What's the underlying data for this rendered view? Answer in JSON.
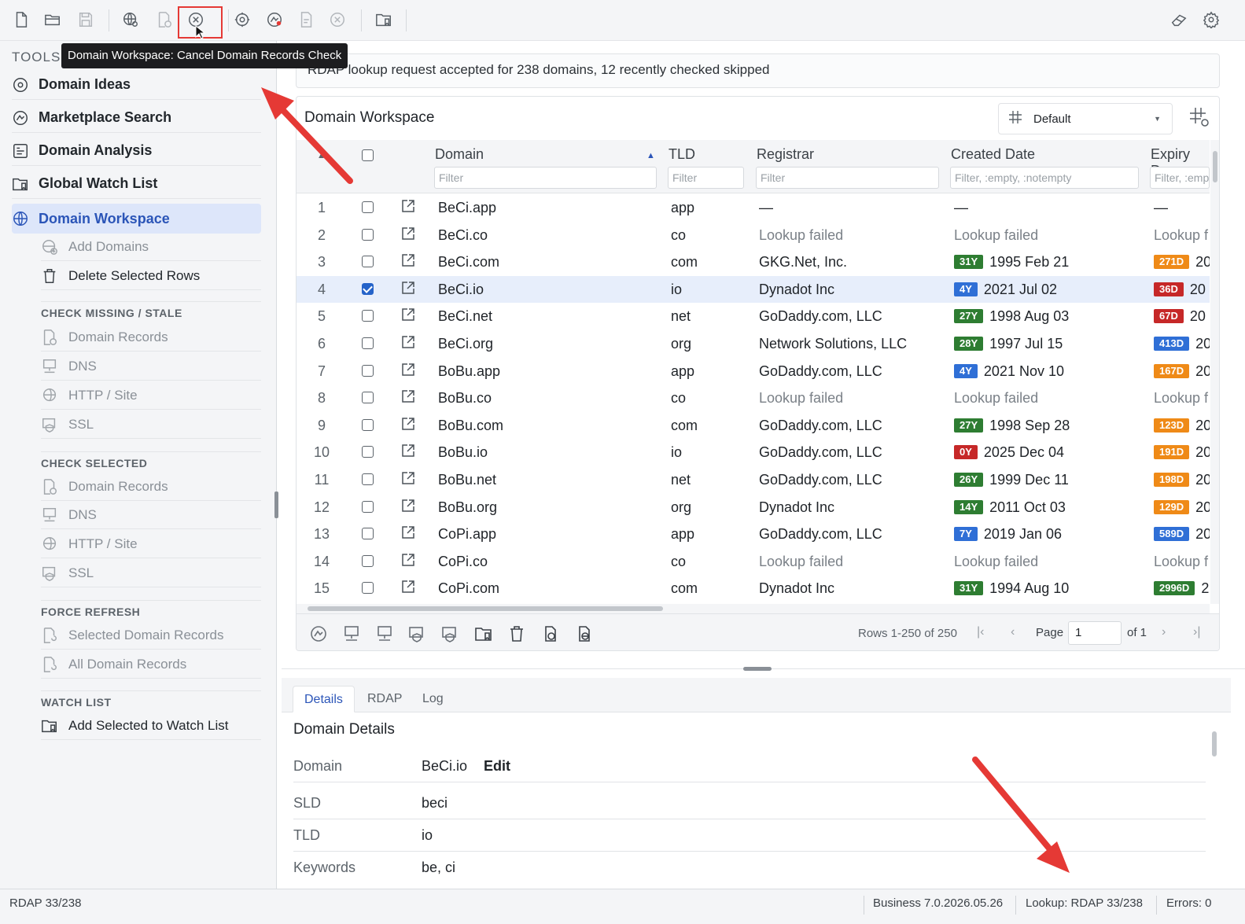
{
  "toolbar": {
    "buttons": [
      {
        "name": "new-icon",
        "disabled": false
      },
      {
        "name": "open-folder-icon",
        "disabled": false
      },
      {
        "name": "save-icon",
        "disabled": true
      },
      {
        "name": "globe-search-icon",
        "disabled": false
      },
      {
        "name": "domain-records-icon",
        "disabled": true
      },
      {
        "name": "cancel-circle-icon",
        "disabled": false
      },
      {
        "name": "gear-badge-icon",
        "disabled": false
      },
      {
        "name": "marketplace-icon",
        "disabled": false
      },
      {
        "name": "document-check-icon",
        "disabled": true
      },
      {
        "name": "cancel-circle-icon",
        "disabled": true
      },
      {
        "name": "watchlist-folder-icon",
        "disabled": false
      },
      {
        "name": "eraser-icon",
        "disabled": false
      },
      {
        "name": "settings-gear-icon",
        "disabled": false
      }
    ],
    "tooltip": "Domain Workspace: Cancel Domain Records Check"
  },
  "sidebar": {
    "tools_label": "TOOLS",
    "main_items": [
      {
        "label": "Domain Ideas",
        "icon": "lightbulb-gear-icon",
        "active": false
      },
      {
        "label": "Marketplace Search",
        "icon": "marketplace-icon",
        "active": false
      },
      {
        "label": "Domain Analysis",
        "icon": "analysis-icon",
        "active": false
      },
      {
        "label": "Global Watch List",
        "icon": "watchlist-folder-icon",
        "active": false
      },
      {
        "label": "Domain Workspace",
        "icon": "globe-grid-icon",
        "active": true
      }
    ],
    "workspace_actions": [
      {
        "label": "Add Domains",
        "icon": "add-globe-icon",
        "enabled": false
      },
      {
        "label": "Delete Selected Rows",
        "icon": "trash-icon",
        "enabled": true
      }
    ],
    "sections": [
      {
        "title": "CHECK MISSING / STALE",
        "items": [
          {
            "label": "Domain Records",
            "icon": "domain-records-icon"
          },
          {
            "label": "DNS",
            "icon": "monitor-network-icon"
          },
          {
            "label": "HTTP / Site",
            "icon": "globe-cursor-icon"
          },
          {
            "label": "SSL",
            "icon": "ssl-certificate-icon"
          }
        ]
      },
      {
        "title": "CHECK SELECTED",
        "items": [
          {
            "label": "Domain Records",
            "icon": "domain-records-icon"
          },
          {
            "label": "DNS",
            "icon": "monitor-network-icon"
          },
          {
            "label": "HTTP / Site",
            "icon": "globe-cursor-icon"
          },
          {
            "label": "SSL",
            "icon": "ssl-certificate-icon"
          }
        ]
      },
      {
        "title": "FORCE REFRESH",
        "items": [
          {
            "label": "Selected Domain Records",
            "icon": "refresh-records-icon"
          },
          {
            "label": "All Domain Records",
            "icon": "refresh-all-icon"
          }
        ]
      },
      {
        "title": "WATCH LIST",
        "items": [
          {
            "label": "Add Selected to Watch List",
            "icon": "watchlist-folder-icon",
            "enabled": true
          }
        ]
      }
    ]
  },
  "status_message": "RDAP lookup request accepted for 238 domains, 12 recently checked skipped",
  "workspace": {
    "title": "Domain Workspace",
    "view_select": "Default",
    "columns": {
      "domain": "Domain",
      "tld": "TLD",
      "registrar": "Registrar",
      "created": "Created Date",
      "expiry": "Expiry Da"
    },
    "filters": {
      "domain": "Filter",
      "tld": "Filter",
      "registrar": "Filter",
      "created": "Filter, :empty, :notempty",
      "expiry": "Filter, :emp"
    },
    "rows": [
      {
        "n": "1",
        "checked": false,
        "domain": "BeCi.app",
        "tld": "app",
        "registrar": "—",
        "registrar_muted": false,
        "age": "",
        "age_color": "",
        "created": "—",
        "expiry_badge": "",
        "expiry_color": "",
        "expiry": "—"
      },
      {
        "n": "2",
        "checked": false,
        "domain": "BeCi.co",
        "tld": "co",
        "registrar": "Lookup failed",
        "registrar_muted": true,
        "age": "",
        "age_color": "",
        "created": "Lookup failed",
        "expiry_badge": "",
        "expiry_color": "",
        "expiry": "Lookup f"
      },
      {
        "n": "3",
        "checked": false,
        "domain": "BeCi.com",
        "tld": "com",
        "registrar": "GKG.Net, Inc.",
        "registrar_muted": false,
        "age": "31Y",
        "age_color": "#2e7d32",
        "created": "1995 Feb 21",
        "expiry_badge": "271D",
        "expiry_color": "#ef8a17",
        "expiry": "20"
      },
      {
        "n": "4",
        "checked": true,
        "domain": "BeCi.io",
        "tld": "io",
        "registrar": "Dynadot Inc",
        "registrar_muted": false,
        "age": "4Y",
        "age_color": "#2f6fd6",
        "created": "2021 Jul 02",
        "expiry_badge": "36D",
        "expiry_color": "#c62828",
        "expiry": "20"
      },
      {
        "n": "5",
        "checked": false,
        "domain": "BeCi.net",
        "tld": "net",
        "registrar": "GoDaddy.com, LLC",
        "registrar_muted": false,
        "age": "27Y",
        "age_color": "#2e7d32",
        "created": "1998 Aug 03",
        "expiry_badge": "67D",
        "expiry_color": "#c62828",
        "expiry": "20"
      },
      {
        "n": "6",
        "checked": false,
        "domain": "BeCi.org",
        "tld": "org",
        "registrar": "Network Solutions, LLC",
        "registrar_muted": false,
        "age": "28Y",
        "age_color": "#2e7d32",
        "created": "1997 Jul 15",
        "expiry_badge": "413D",
        "expiry_color": "#2f6fd6",
        "expiry": "20"
      },
      {
        "n": "7",
        "checked": false,
        "domain": "BoBu.app",
        "tld": "app",
        "registrar": "GoDaddy.com, LLC",
        "registrar_muted": false,
        "age": "4Y",
        "age_color": "#2f6fd6",
        "created": "2021 Nov 10",
        "expiry_badge": "167D",
        "expiry_color": "#ef8a17",
        "expiry": "20"
      },
      {
        "n": "8",
        "checked": false,
        "domain": "BoBu.co",
        "tld": "co",
        "registrar": "Lookup failed",
        "registrar_muted": true,
        "age": "",
        "age_color": "",
        "created": "Lookup failed",
        "expiry_badge": "",
        "expiry_color": "",
        "expiry": "Lookup f"
      },
      {
        "n": "9",
        "checked": false,
        "domain": "BoBu.com",
        "tld": "com",
        "registrar": "GoDaddy.com, LLC",
        "registrar_muted": false,
        "age": "27Y",
        "age_color": "#2e7d32",
        "created": "1998 Sep 28",
        "expiry_badge": "123D",
        "expiry_color": "#ef8a17",
        "expiry": "20"
      },
      {
        "n": "10",
        "checked": false,
        "domain": "BoBu.io",
        "tld": "io",
        "registrar": "GoDaddy.com, LLC",
        "registrar_muted": false,
        "age": "0Y",
        "age_color": "#c62828",
        "created": "2025 Dec 04",
        "expiry_badge": "191D",
        "expiry_color": "#ef8a17",
        "expiry": "20"
      },
      {
        "n": "11",
        "checked": false,
        "domain": "BoBu.net",
        "tld": "net",
        "registrar": "GoDaddy.com, LLC",
        "registrar_muted": false,
        "age": "26Y",
        "age_color": "#2e7d32",
        "created": "1999 Dec 11",
        "expiry_badge": "198D",
        "expiry_color": "#ef8a17",
        "expiry": "20"
      },
      {
        "n": "12",
        "checked": false,
        "domain": "BoBu.org",
        "tld": "org",
        "registrar": "Dynadot Inc",
        "registrar_muted": false,
        "age": "14Y",
        "age_color": "#2e7d32",
        "created": "2011 Oct 03",
        "expiry_badge": "129D",
        "expiry_color": "#ef8a17",
        "expiry": "20"
      },
      {
        "n": "13",
        "checked": false,
        "domain": "CoPi.app",
        "tld": "app",
        "registrar": "GoDaddy.com, LLC",
        "registrar_muted": false,
        "age": "7Y",
        "age_color": "#2f6fd6",
        "created": "2019 Jan 06",
        "expiry_badge": "589D",
        "expiry_color": "#2f6fd6",
        "expiry": "20"
      },
      {
        "n": "14",
        "checked": false,
        "domain": "CoPi.co",
        "tld": "co",
        "registrar": "Lookup failed",
        "registrar_muted": true,
        "age": "",
        "age_color": "",
        "created": "Lookup failed",
        "expiry_badge": "",
        "expiry_color": "",
        "expiry": "Lookup f"
      },
      {
        "n": "15",
        "checked": false,
        "domain": "CoPi.com",
        "tld": "com",
        "registrar": "Dynadot Inc",
        "registrar_muted": false,
        "age": "31Y",
        "age_color": "#2e7d32",
        "created": "1994 Aug 10",
        "expiry_badge": "2996D",
        "expiry_color": "#2e7d32",
        "expiry": "2"
      }
    ],
    "footer": {
      "rows_count": "Rows 1-250 of 250",
      "page_label": "Page",
      "page_value": "1",
      "page_of": "of 1"
    }
  },
  "details": {
    "tabs": [
      {
        "label": "Details",
        "active": true
      },
      {
        "label": "RDAP",
        "active": false
      },
      {
        "label": "Log",
        "active": false
      }
    ],
    "title": "Domain Details",
    "fields": [
      {
        "key": "Domain",
        "value": "BeCi.io",
        "edit": "Edit"
      },
      {
        "key": "SLD",
        "value": "beci",
        "edit": ""
      },
      {
        "key": "TLD",
        "value": "io",
        "edit": ""
      },
      {
        "key": "Keywords",
        "value": "be, ci",
        "edit": ""
      }
    ]
  },
  "statusbar": {
    "left": "RDAP 33/238",
    "version": "Business 7.0.2026.05.26",
    "lookup": "Lookup: RDAP 33/238",
    "errors": "Errors: 0"
  },
  "colors": {
    "accent": "#2b55b8",
    "selected_row": "#e7eefb",
    "annotation_red": "#e53935"
  }
}
